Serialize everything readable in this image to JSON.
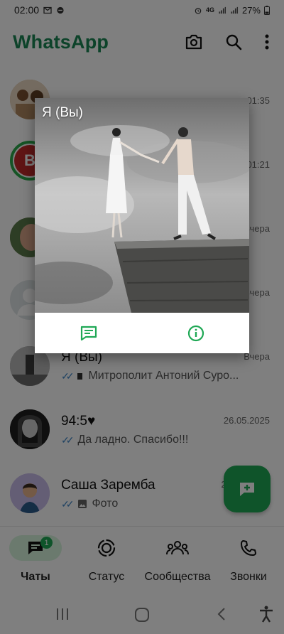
{
  "status_bar": {
    "time": "02:00",
    "network": "4G",
    "battery": "27%"
  },
  "app": {
    "title": "WhatsApp"
  },
  "chats": [
    {
      "name": "",
      "time": "01:35",
      "message": ""
    },
    {
      "name": "",
      "time": "01:21",
      "message": ""
    },
    {
      "name": "",
      "time": "Вчера",
      "message": ""
    },
    {
      "name": "",
      "time": "Вчера",
      "message": ""
    },
    {
      "name": "Я (Вы)",
      "time": "Вчера",
      "message": "Митрополит Антоний Суро..."
    },
    {
      "name": "94:5",
      "time": "26.05.2025",
      "message": "Да ладно. Спасибо!!!"
    },
    {
      "name": "Саша Заремба",
      "time": "26",
      "message": "Фото"
    }
  ],
  "popup": {
    "title": "Я (Вы)",
    "actions": [
      "message-icon",
      "info-icon"
    ]
  },
  "bottom_nav": {
    "items": [
      {
        "label": "Чаты",
        "icon": "chats-icon",
        "badge": "1",
        "active": true
      },
      {
        "label": "Статус",
        "icon": "status-icon"
      },
      {
        "label": "Сообщества",
        "icon": "communities-icon"
      },
      {
        "label": "Звонки",
        "icon": "calls-icon"
      }
    ]
  },
  "colors": {
    "brand": "#1b8755",
    "accent": "#1fa855",
    "active_pill": "#d7f5dd",
    "read_ticks": "#3b82c4"
  }
}
